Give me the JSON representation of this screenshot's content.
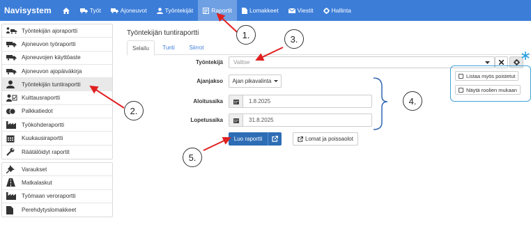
{
  "navbar": {
    "brand": "Navisystem",
    "items": [
      {
        "label": "",
        "icon": "home-icon"
      },
      {
        "label": "Työt",
        "icon": "truck-icon"
      },
      {
        "label": "Ajoneuvot",
        "icon": "truck-icon"
      },
      {
        "label": "Työntekijät",
        "icon": "user-icon"
      },
      {
        "label": "Raportit",
        "icon": "report-icon",
        "active": true
      },
      {
        "label": "Lomakkeet",
        "icon": "file-icon"
      },
      {
        "label": "Viestit",
        "icon": "envelope-icon"
      },
      {
        "label": "Hallinta",
        "icon": "gear-icon"
      }
    ]
  },
  "sidebar": {
    "group1": [
      {
        "label": "Työntekijän ajoraportti",
        "icon": "driver-truck-icon"
      },
      {
        "label": "Ajoneuvon työraportti",
        "icon": "truck-icon"
      },
      {
        "label": "Ajoneuvojen käyttöaste",
        "icon": "truck-icon"
      },
      {
        "label": "Ajoneuvon ajopäiväkirja",
        "icon": "truck-icon"
      },
      {
        "label": "Työntekijän tuntiraportti",
        "icon": "user-icon",
        "active": true
      },
      {
        "label": "Kuittausraportti",
        "icon": "user-check-icon"
      },
      {
        "label": "Palkkatiedot",
        "icon": "money-icon"
      },
      {
        "label": "Työkohderaportti",
        "icon": "factory-icon"
      },
      {
        "label": "Kuukausiraportti",
        "icon": "calendar-icon"
      },
      {
        "label": "Räätälöidyt raportit",
        "icon": "wrench-icon"
      }
    ],
    "group2": [
      {
        "label": "Varaukset",
        "icon": "pin-icon"
      },
      {
        "label": "Matkalaskut",
        "icon": "road-icon"
      },
      {
        "label": "Työmaan veroraportti",
        "icon": "factory-icon"
      },
      {
        "label": "Perehdytyslomakkeet",
        "icon": "file-icon"
      }
    ]
  },
  "main": {
    "title": "Työntekijän tuntiraportti",
    "tabs": [
      "Selailu",
      "Tunti",
      "Siirrot"
    ],
    "form": {
      "employee_label": "Työntekijä",
      "employee_placeholder": "Valitse",
      "period_label": "Ajanjakso",
      "period_value": "Ajan pikavalinta",
      "start_label": "Aloitusaika",
      "start_value": "1.8.2025",
      "end_label": "Lopetusaika",
      "end_value": "31.8.2025",
      "create_button": "Luo raportti",
      "absences_button": "Lomat ja poissaolot"
    },
    "options": {
      "show_deleted": "Listaa myös poistetut",
      "show_by_role": "Näytä roolien mukaan"
    }
  },
  "annotations": [
    "1.",
    "2.",
    "3.",
    "4.",
    "5."
  ],
  "colors": {
    "navbar": "#3c7dd8",
    "primary": "#2d6db5",
    "arrow": "#e02020",
    "bracket": "#2f66b3",
    "options_border": "#3fa4d8"
  }
}
